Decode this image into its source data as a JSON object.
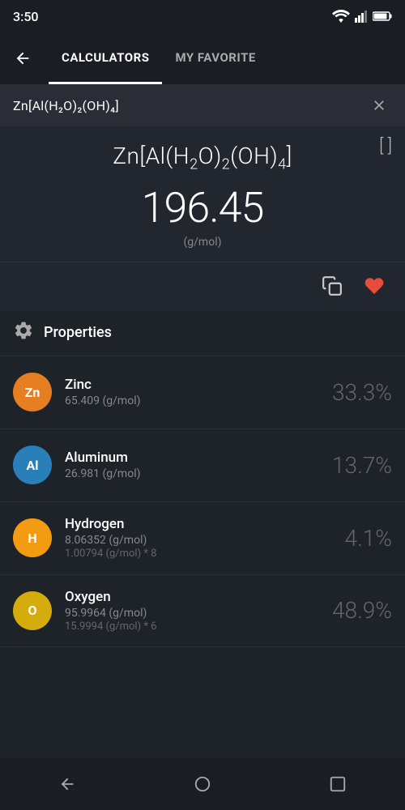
{
  "statusBar": {
    "time": "3:50"
  },
  "nav": {
    "tab1": "CALCULATORS",
    "tab2": "MY FAVORITE",
    "activeTab": 0
  },
  "searchBar": {
    "value": "Zn[Al(H₂O)₂(OH)₄]",
    "clearLabel": "×"
  },
  "formula": {
    "display": "Zn[Al(H₂O)₂(OH)₄]",
    "molarMass": "196.45",
    "unit": "(g/mol)"
  },
  "actions": {
    "copyLabel": "copy",
    "favoriteLabel": "favorite"
  },
  "properties": {
    "title": "Properties"
  },
  "elements": [
    {
      "symbol": "Zn",
      "name": "Zinc",
      "mass": "65.409 (g/mol)",
      "calc": "",
      "percent": "33.3%",
      "color": "#e67e22"
    },
    {
      "symbol": "Al",
      "name": "Aluminum",
      "mass": "26.981 (g/mol)",
      "calc": "",
      "percent": "13.7%",
      "color": "#2980b9"
    },
    {
      "symbol": "H",
      "name": "Hydrogen",
      "mass": "8.06352 (g/mol)",
      "calc": "1.00794 (g/mol) * 8",
      "percent": "4.1%",
      "color": "#f39c12"
    },
    {
      "symbol": "O",
      "name": "Oxygen",
      "mass": "95.9964 (g/mol)",
      "calc": "15.9994 (g/mol) * 6",
      "percent": "48.9%",
      "color": "#d4ac0d"
    }
  ],
  "navBar": {
    "back": "back",
    "home": "home",
    "recents": "recents"
  }
}
